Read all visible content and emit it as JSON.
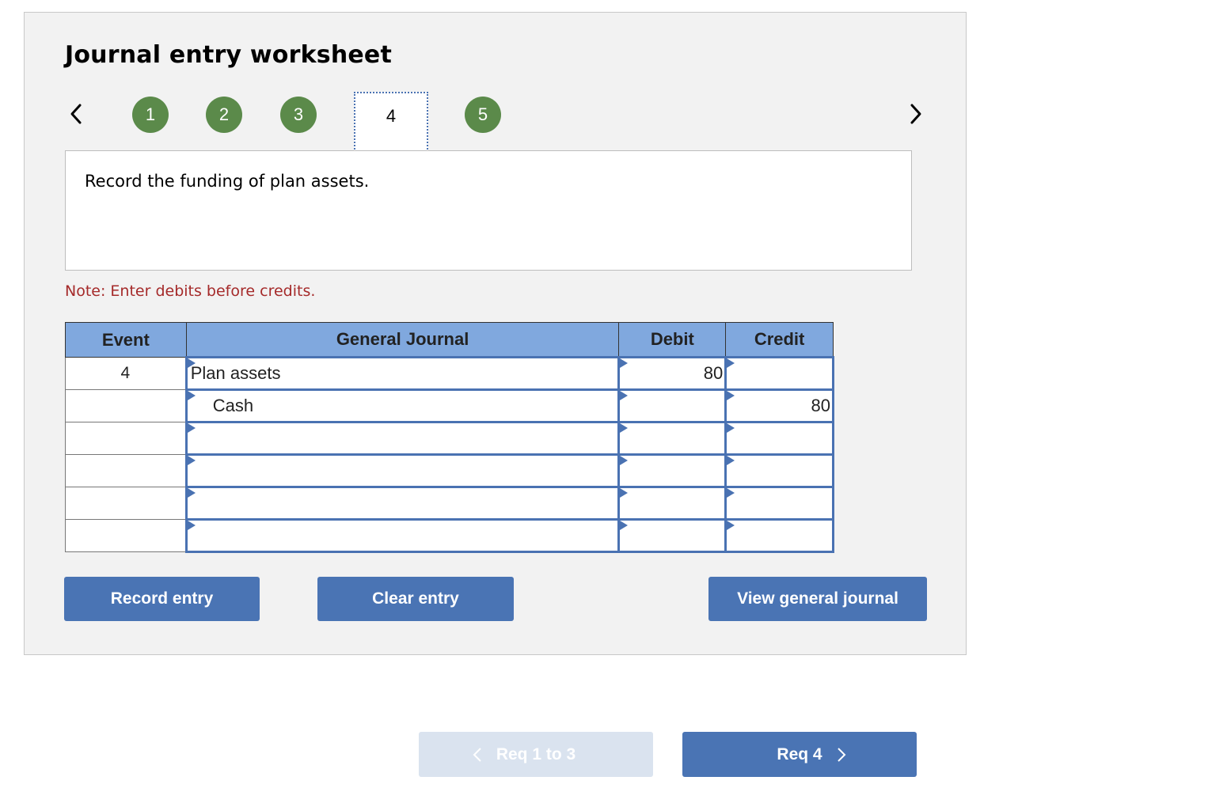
{
  "worksheet": {
    "title": "Journal entry worksheet",
    "nav": {
      "prev_icon": "chevron-left-icon",
      "next_icon": "chevron-right-icon"
    },
    "steps": [
      {
        "label": "1",
        "state": "completed"
      },
      {
        "label": "2",
        "state": "completed"
      },
      {
        "label": "3",
        "state": "completed"
      },
      {
        "label": "4",
        "state": "current"
      },
      {
        "label": "5",
        "state": "completed"
      }
    ],
    "instruction": "Record the funding of plan assets.",
    "note": "Note: Enter debits before credits."
  },
  "journal_table": {
    "headers": {
      "event": "Event",
      "general_journal": "General Journal",
      "debit": "Debit",
      "credit": "Credit"
    },
    "rows": [
      {
        "event": "4",
        "account": "Plan assets",
        "indent": false,
        "debit": "80",
        "credit": ""
      },
      {
        "event": "",
        "account": "Cash",
        "indent": true,
        "debit": "",
        "credit": "80"
      },
      {
        "event": "",
        "account": "",
        "indent": false,
        "debit": "",
        "credit": ""
      },
      {
        "event": "",
        "account": "",
        "indent": false,
        "debit": "",
        "credit": ""
      },
      {
        "event": "",
        "account": "",
        "indent": false,
        "debit": "",
        "credit": ""
      },
      {
        "event": "",
        "account": "",
        "indent": false,
        "debit": "",
        "credit": ""
      }
    ]
  },
  "actions": {
    "record_entry": "Record entry",
    "clear_entry": "Clear entry",
    "view_general_journal": "View general journal"
  },
  "req_nav": {
    "prev_label": "Req 1 to 3",
    "prev_disabled": true,
    "next_label": "Req 4"
  },
  "colors": {
    "step_completed": "#5b8a4a",
    "header_bg": "#80a8de",
    "input_border": "#4a72b2",
    "button_bg": "#4a74b4",
    "button_disabled_bg": "#dae3ef",
    "note_text": "#a52a2a"
  }
}
